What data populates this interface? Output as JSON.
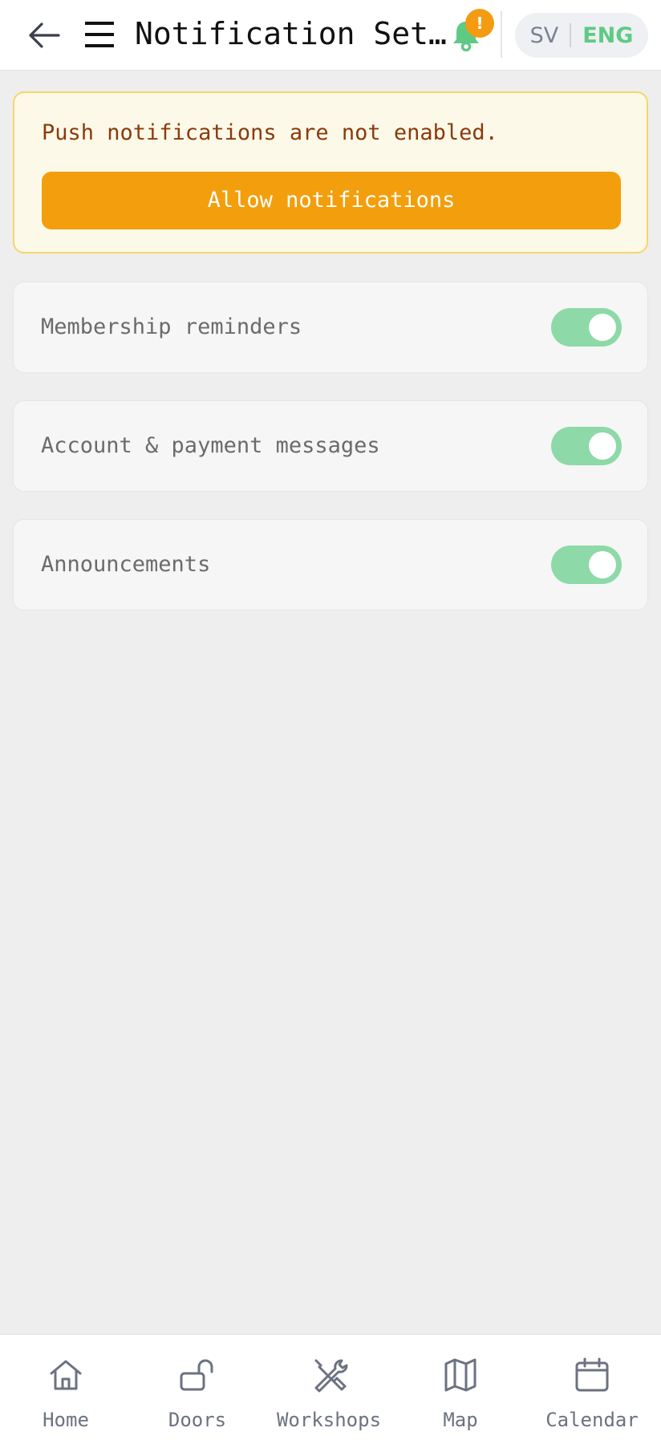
{
  "header": {
    "title": "Notification Settings",
    "back_icon": "arrow-left-icon",
    "menu_icon": "hamburger-icon",
    "bell_icon": "bell-icon",
    "bell_badge": "!",
    "lang": {
      "sv": "SV",
      "eng": "ENG",
      "active": "ENG"
    }
  },
  "warning": {
    "message": "Push notifications are not enabled.",
    "button_label": "Allow notifications"
  },
  "settings": [
    {
      "label": "Membership reminders",
      "enabled": true
    },
    {
      "label": "Account & payment messages",
      "enabled": true
    },
    {
      "label": "Announcements",
      "enabled": true
    }
  ],
  "nav": [
    {
      "label": "Home",
      "icon": "home-icon"
    },
    {
      "label": "Doors",
      "icon": "unlock-icon"
    },
    {
      "label": "Workshops",
      "icon": "tools-icon"
    },
    {
      "label": "Map",
      "icon": "map-icon"
    },
    {
      "label": "Calendar",
      "icon": "calendar-icon"
    }
  ],
  "colors": {
    "accent_green": "#5fca84",
    "toggle_on": "#8dd9a8",
    "warning_orange": "#f39e0c",
    "warning_text": "#8a3a0e"
  }
}
